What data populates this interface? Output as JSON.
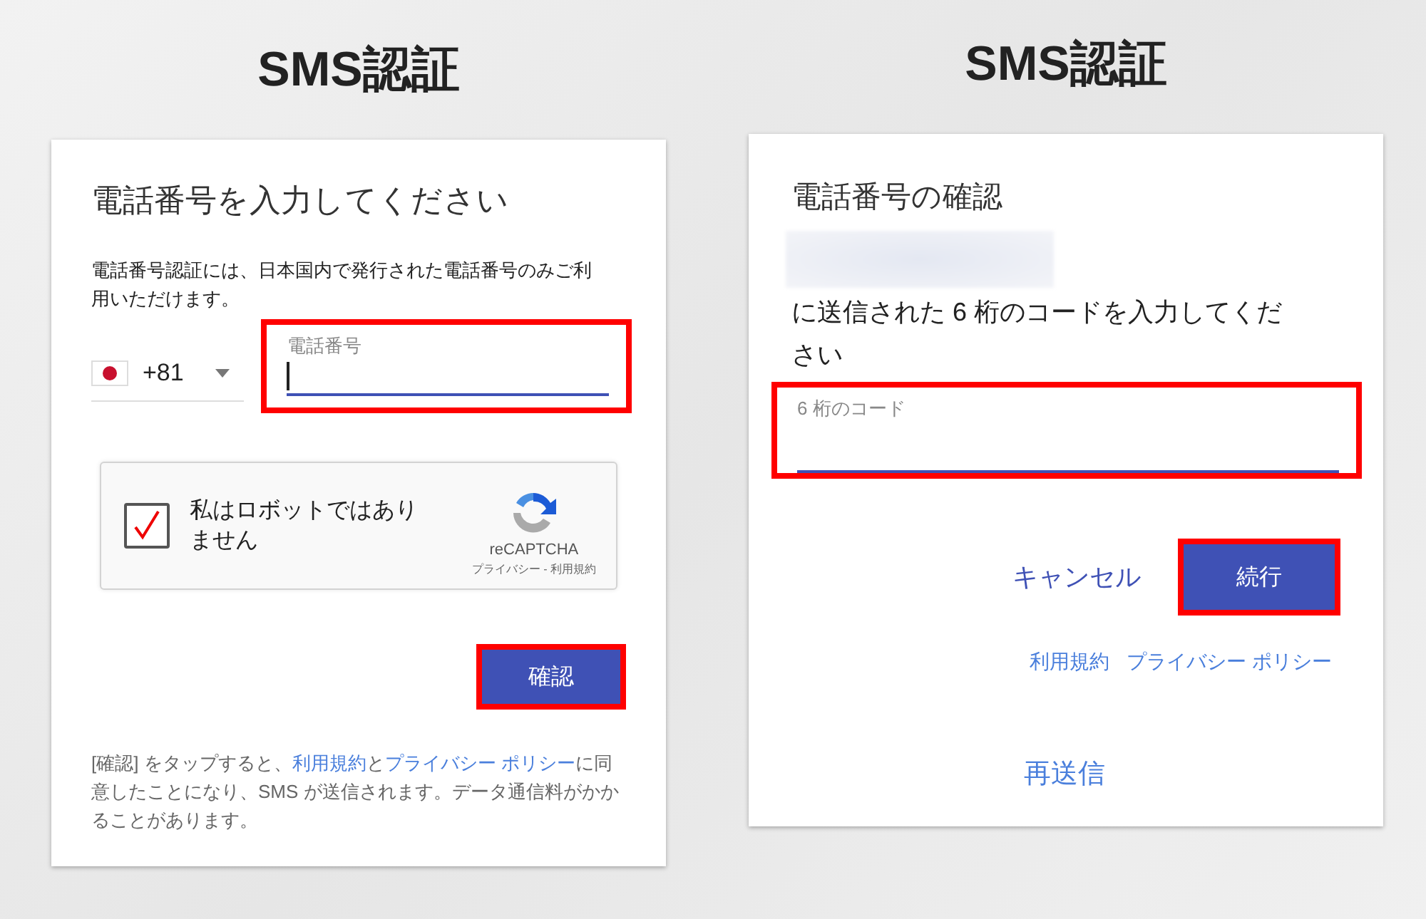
{
  "left": {
    "heading": "SMS認証",
    "card": {
      "title": "電話番号を入力してください",
      "note": "電話番号認証には、日本国内で発行された電話番号のみご利用いただけます。",
      "country_code": "+81",
      "phone_field": {
        "label": "電話番号",
        "focused": true,
        "highlighted": true
      },
      "captcha": {
        "label": "私はロボットではありません",
        "checked": true,
        "brand": "reCAPTCHA",
        "footer": "プライバシー - 利用規約"
      },
      "confirm_button": {
        "label": "確認",
        "highlighted": true
      },
      "disclaimer": [
        {
          "text": "[確認] をタップすると、",
          "link": false
        },
        {
          "text": "利用規約",
          "link": true
        },
        {
          "text": "と",
          "link": false
        },
        {
          "text": "プライバシー ポリシー",
          "link": true
        },
        {
          "text": "に同意したことになり、SMS が送信されます。データ通信料がかかることがあります。",
          "link": false
        }
      ]
    }
  },
  "right": {
    "heading": "SMS認証",
    "card": {
      "title": "電話番号の確認",
      "number_hidden": true,
      "instruction": "に送信された 6 桁のコードを入力してください",
      "code_field": {
        "label": "6 桁のコード",
        "focused": false,
        "highlighted": true
      },
      "cancel_button": {
        "label": "キャンセル",
        "highlighted": false
      },
      "continue_button": {
        "label": "続行",
        "highlighted": true
      },
      "links": [
        "利用規約",
        "プライバシー ポリシー"
      ],
      "resend": "再送信"
    }
  }
}
